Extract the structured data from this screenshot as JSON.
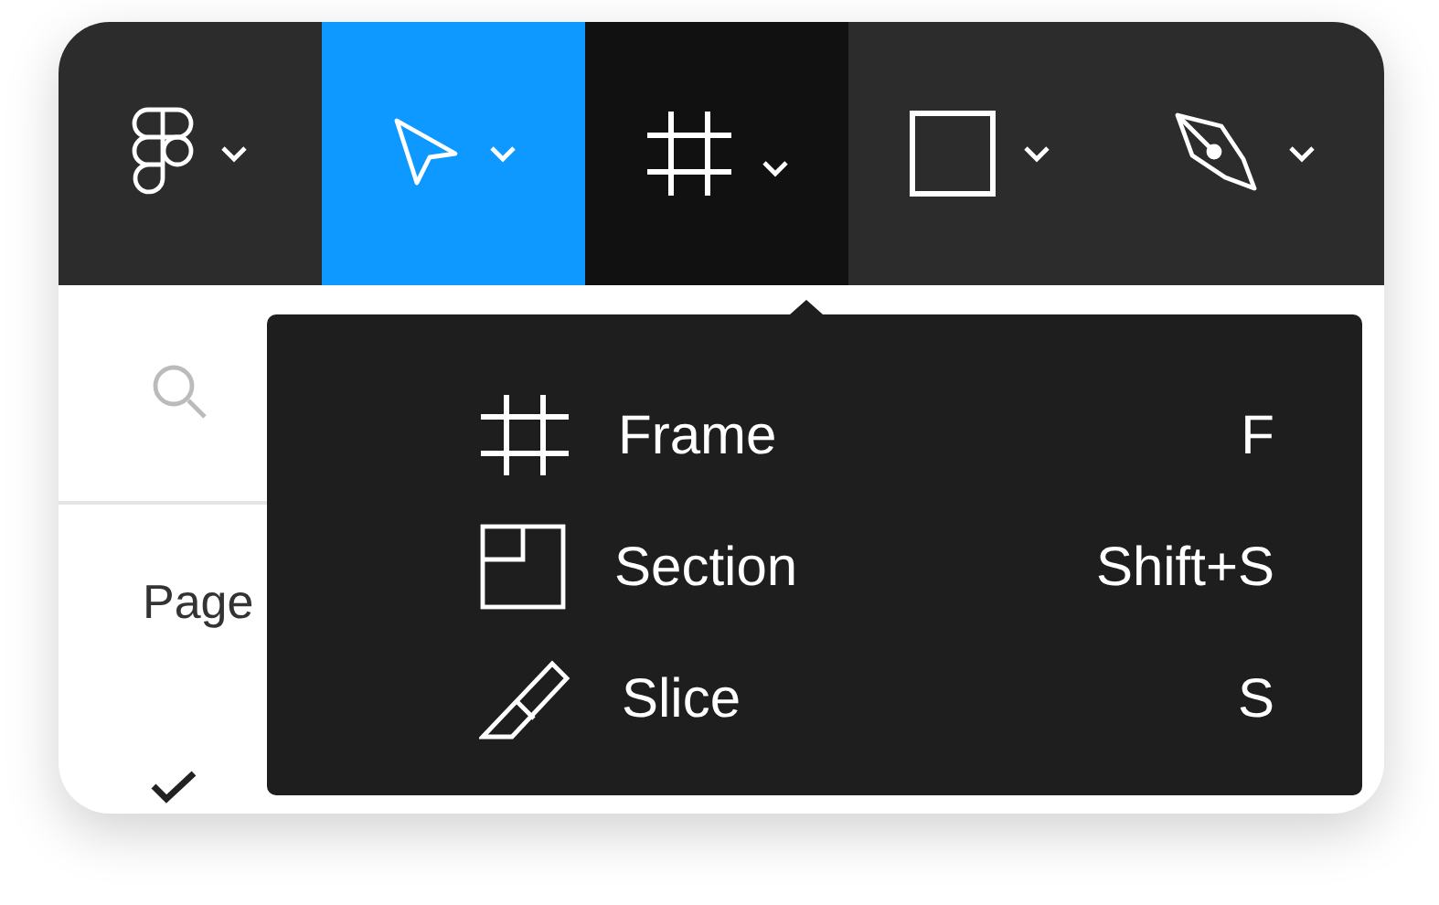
{
  "toolbar": [
    {
      "kind": "logo",
      "selected": false,
      "open": false
    },
    {
      "kind": "move",
      "selected": true,
      "open": false
    },
    {
      "kind": "frame",
      "selected": false,
      "open": true
    },
    {
      "kind": "rectangle",
      "selected": false,
      "open": false
    },
    {
      "kind": "pen",
      "selected": false,
      "open": false
    }
  ],
  "sidebar": {
    "section_title": "Page",
    "pages": [
      {
        "selected": true
      }
    ]
  },
  "menu": [
    {
      "kind": "frame",
      "label": "Frame",
      "shortcut": "F"
    },
    {
      "kind": "section",
      "label": "Section",
      "shortcut": "Shift+S"
    },
    {
      "kind": "slice",
      "label": "Slice",
      "shortcut": "S"
    }
  ]
}
